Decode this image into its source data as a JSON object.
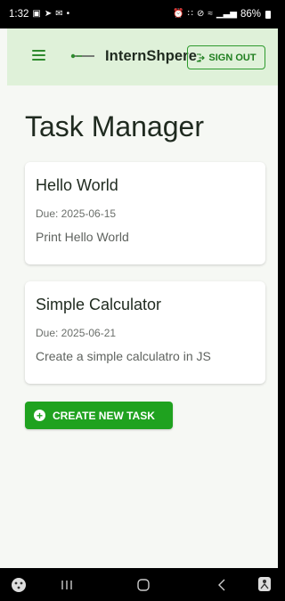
{
  "status_bar": {
    "time": "1:32",
    "left_icons": [
      "notification-icon",
      "send-icon",
      "mail-icon",
      "dot-icon"
    ],
    "right_icons": [
      "alarm-icon",
      "bluetooth-icon",
      "mute-icon",
      "wifi-icon",
      "signal-icon",
      "signal-icon",
      "battery-icon"
    ],
    "battery": "86%"
  },
  "header": {
    "title": "InternShpere",
    "signout_label": "SIGN OUT",
    "accent_color": "#2e9b2e",
    "background_color": "#dff1d9"
  },
  "main": {
    "page_title": "Task Manager",
    "tasks": [
      {
        "title": "Hello World",
        "due": "Due: 2025-06-15",
        "description": "Print Hello World"
      },
      {
        "title": "Simple Calculator",
        "due": "Due: 2025-06-21",
        "description": "Create a simple calculatro in JS"
      }
    ],
    "create_button_label": "CREATE NEW TASK",
    "create_button_color": "#1fa21f"
  },
  "nav_bar": {
    "items": [
      "app-drawer-icon",
      "recent-apps-icon",
      "home-icon",
      "back-icon",
      "accessibility-icon"
    ]
  }
}
